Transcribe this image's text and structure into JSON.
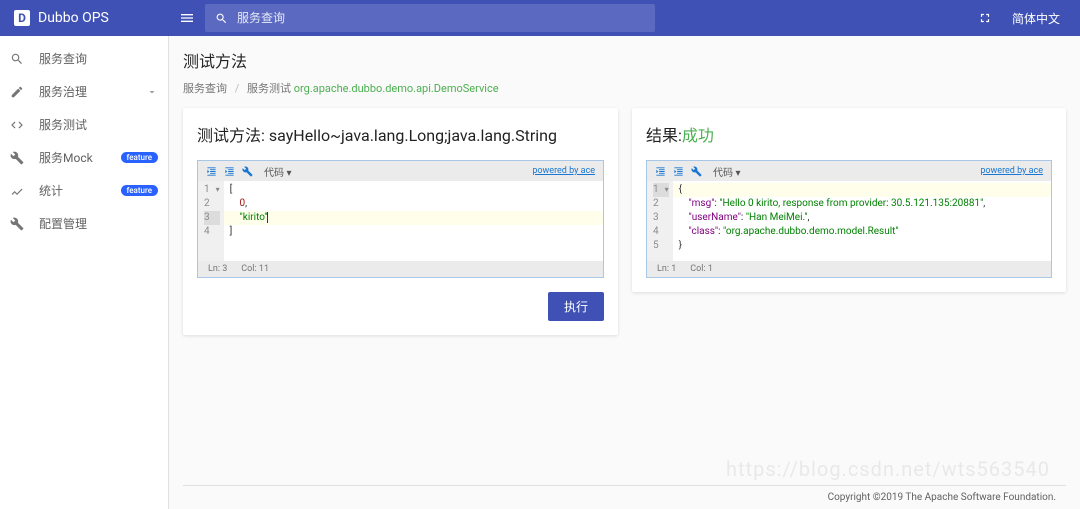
{
  "header": {
    "brand": "Dubbo OPS",
    "search_placeholder": "服务查询",
    "lang": "简体中文"
  },
  "sidebar": {
    "items": [
      {
        "label": "服务查询",
        "icon": "search"
      },
      {
        "label": "服务治理",
        "icon": "edit",
        "expand": true
      },
      {
        "label": "服务测试",
        "icon": "code"
      },
      {
        "label": "服务Mock",
        "icon": "wrench",
        "badge": "feature"
      },
      {
        "label": "统计",
        "icon": "trend",
        "badge": "feature"
      },
      {
        "label": "配置管理",
        "icon": "wrench"
      }
    ]
  },
  "page": {
    "title": "测试方法",
    "breadcrumb": {
      "root": "服务查询",
      "second": "服务测试",
      "service": "org.apache.dubbo.demo.api.DemoService"
    }
  },
  "left_card": {
    "title_prefix": "测试方法: ",
    "method": "sayHello~java.lang.Long;java.lang.String",
    "toolbar_label": "代码",
    "powered": "powered by ace",
    "gutter": [
      "1",
      "2",
      "3",
      "4"
    ],
    "lines": {
      "l1": "[",
      "l2": "0",
      "l3": "\"kirito\"",
      "l4": "]"
    },
    "status_ln": "Ln: 3",
    "status_col": "Col: 11",
    "run": "执行"
  },
  "right_card": {
    "title_prefix": "结果:",
    "status": "成功",
    "toolbar_label": "代码",
    "powered": "powered by ace",
    "gutter": [
      "1",
      "2",
      "3",
      "4",
      "5"
    ],
    "json": {
      "msg_key": "\"msg\"",
      "msg_val": "\"Hello 0 kirito, response from provider: 30.5.121.135:20881\"",
      "user_key": "\"userName\"",
      "user_val": "\"Han MeiMei.\"",
      "class_key": "\"class\"",
      "class_val": "\"org.apache.dubbo.demo.model.Result\""
    },
    "status_ln": "Ln: 1",
    "status_col": "Col: 1"
  },
  "footer": "Copyright ©2019 The Apache Software Foundation.",
  "watermark": "https://blog.csdn.net/wts563540"
}
